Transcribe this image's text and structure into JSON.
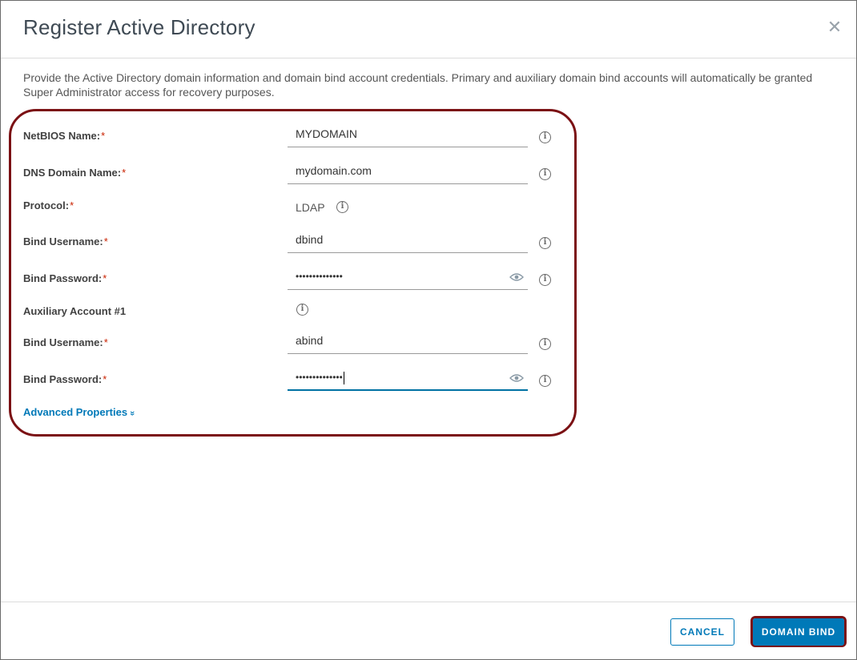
{
  "dialog": {
    "title": "Register Active Directory",
    "close_icon": "close-icon",
    "description": "Provide the Active Directory domain information and domain bind account credentials. Primary and auxiliary domain bind accounts will automatically be granted Super Administrator access for recovery purposes."
  },
  "form": {
    "netbios": {
      "label": "NetBIOS Name:",
      "required": "*",
      "value": "MYDOMAIN"
    },
    "dns": {
      "label": "DNS Domain Name:",
      "required": "*",
      "value": "mydomain.com"
    },
    "protocol": {
      "label": "Protocol:",
      "required": "*",
      "value": "LDAP"
    },
    "bind_username": {
      "label": "Bind Username:",
      "required": "*",
      "value": "dbind"
    },
    "bind_password": {
      "label": "Bind Password:",
      "required": "*",
      "masked": "••••••••••••••"
    },
    "aux_section": {
      "label": "Auxiliary Account #1"
    },
    "aux_username": {
      "label": "Bind Username:",
      "required": "*",
      "value": "abind"
    },
    "aux_password": {
      "label": "Bind Password:",
      "required": "*",
      "masked": "••••••••••••••"
    },
    "advanced_link": "Advanced Properties",
    "advanced_chevron": "»"
  },
  "footer": {
    "cancel_label": "CANCEL",
    "bind_label": "DOMAIN BIND"
  },
  "colors": {
    "primary": "#0079b8",
    "required": "#c92100",
    "highlight": "#7b1114"
  },
  "icons": {
    "info": "info-icon",
    "eye": "eye-icon",
    "close": "close-icon"
  }
}
